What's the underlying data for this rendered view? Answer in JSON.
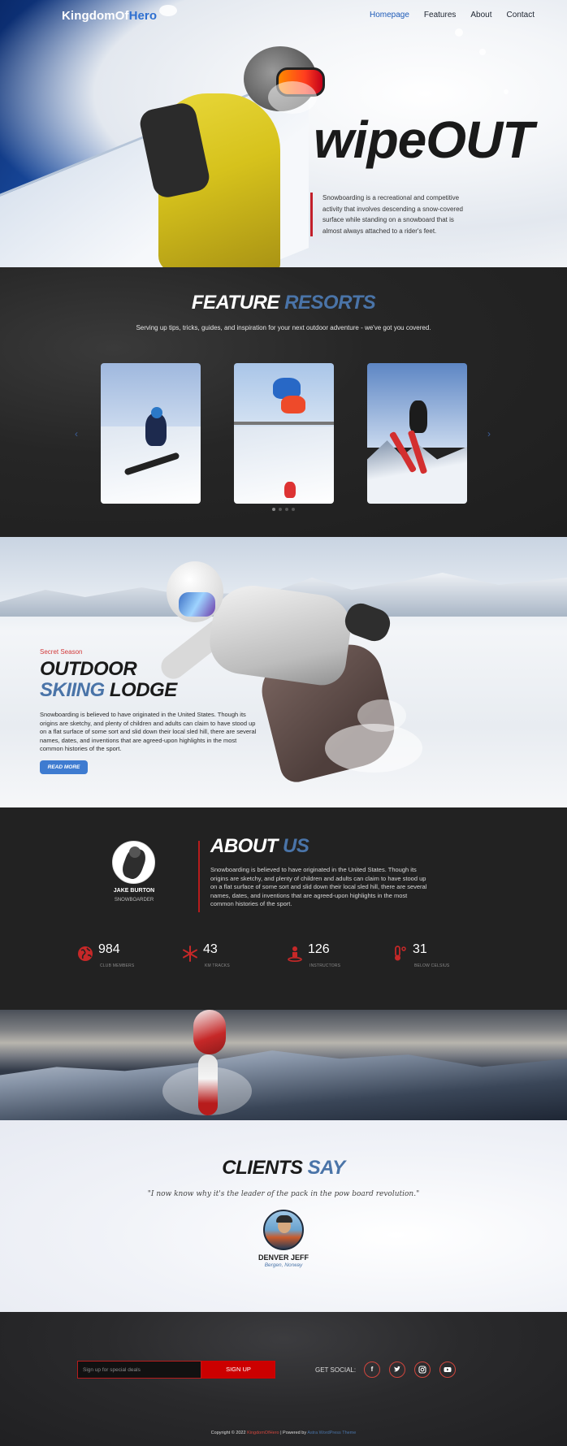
{
  "nav": {
    "logo_part1": "KingdomOf",
    "logo_part2": "Hero",
    "items": [
      {
        "label": "Homepage",
        "active": true
      },
      {
        "label": "Features",
        "active": false
      },
      {
        "label": "About",
        "active": false
      },
      {
        "label": "Contact",
        "active": false
      }
    ]
  },
  "hero": {
    "title": "wipeOUT",
    "text": "Snowboarding is a recreational and competitive activity that involves descending a snow-covered surface while standing on a snowboard that is almost always attached to a rider's feet."
  },
  "resorts": {
    "title_part1": "FEATURE",
    "title_part2": "RESORTS",
    "subtitle": "Serving up tips, tricks, guides, and inspiration for your next outdoor adventure - we've got you covered.",
    "prev_arrow": "‹",
    "next_arrow": "›",
    "dots": 4,
    "active_dot": 0
  },
  "lodge": {
    "kicker": "Secret Season",
    "title_line1": "OUTDOOR",
    "title_line2_blue": "SKIING",
    "title_line2_rest": "LODGE",
    "body": "Snowboarding is believed to have originated in the United States. Though its origins are sketchy, and plenty of children and adults can claim to have stood up on a flat surface of some sort and slid down their local sled hill, there are several names, dates, and inventions that are agreed-upon highlights in the most common histories of the sport.",
    "button": "READ MORE"
  },
  "about": {
    "name": "JAKE BURTON",
    "role": "SNOWBOARDER",
    "title_part1": "ABOUT",
    "title_part2": "US",
    "text": "Snowboarding is believed to have originated in the United States. Though its origins are sketchy, and plenty of children and adults can claim to have stood up on a flat surface of some sort and slid down their local sled hill, there are several names, dates, and inventions that are agreed-upon highlights in the most common histories of the sport.",
    "stats": [
      {
        "value": "984",
        "label": "CLUB MEMBERS",
        "icon": "globe-icon"
      },
      {
        "value": "43",
        "label": "KM TRACKS",
        "icon": "snowflake-icon"
      },
      {
        "value": "126",
        "label": "INSTRUCTORS",
        "icon": "person-icon"
      },
      {
        "value": "31",
        "label": "BELOW CELSIUS",
        "icon": "thermometer-icon"
      }
    ]
  },
  "clients": {
    "title_part1": "CLIENTS",
    "title_part2": "SAY",
    "quote": "\"I now know why it's the leader of the pack in the pow board revolution.\"",
    "name": "DENVER JEFF",
    "location": "Bergen, Norway"
  },
  "footer": {
    "signup_placeholder": "Sign up for special deals",
    "signup_button": "SIGN UP",
    "social_label": "GET SOCIAL:",
    "social_icons": [
      "facebook-icon",
      "twitter-icon",
      "instagram-icon",
      "youtube-icon"
    ],
    "copyright_prefix": "Copyright © 2022",
    "copyright_brand": "KingdomOfHero",
    "copyright_mid": "| Powered by",
    "copyright_theme": "Astra WordPress Theme"
  },
  "colors": {
    "accent_blue": "#4a74a8",
    "nav_active": "#1e5bb8",
    "accent_red": "#c00000",
    "dark_bg": "#222222"
  }
}
